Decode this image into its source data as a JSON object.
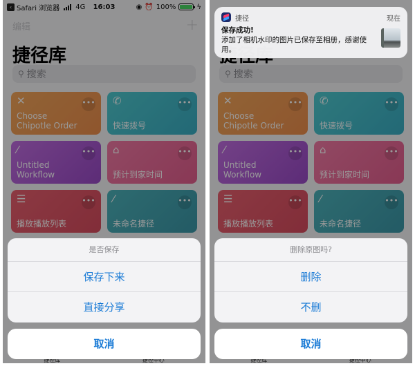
{
  "status_bar": {
    "back_app": "Safari 浏览器",
    "network": "4G",
    "time": "16:03",
    "battery": "100%",
    "battery_level": 1.0
  },
  "app": {
    "edit_label": "编辑",
    "add_icon": "+",
    "title": "捷径库",
    "search_placeholder": "搜索",
    "tiles": [
      {
        "label": "Choose Chipotle Order",
        "icon": "fork-knife-icon",
        "glyph": "✕",
        "color": "#f0a057"
      },
      {
        "label": "快速拨号",
        "icon": "phone-icon",
        "glyph": "✆",
        "color": "#4cc3c9"
      },
      {
        "label": "Untitled Workflow",
        "icon": "magic-wand-icon",
        "glyph": "⁄",
        "color": "#b05cd6"
      },
      {
        "label": "预计到家时间",
        "icon": "home-icon",
        "glyph": "⌂",
        "color": "#ee6f9e"
      },
      {
        "label": "播放播放列表",
        "icon": "list-icon",
        "glyph": "☰",
        "color": "#e15a6a"
      },
      {
        "label": "未命名捷径",
        "icon": "magic-wand-icon",
        "glyph": "⁄",
        "color": "#47aab3"
      }
    ],
    "more_glyph": "•••",
    "tabbar": [
      "捷径库",
      "捷径中心"
    ]
  },
  "left_sheet": {
    "title": "是否保存",
    "actions": [
      "保存下来",
      "直接分享"
    ],
    "cancel": "取消"
  },
  "right_sheet": {
    "title": "删除原图吗?",
    "actions": [
      "删除",
      "不删"
    ],
    "cancel": "取消"
  },
  "notification": {
    "app_name": "捷径",
    "time": "现在",
    "title": "保存成功!",
    "message": "添加了相机水印的图片已保存至相册，感谢使用。"
  },
  "colors": {
    "accent": "#1a7bd6"
  }
}
